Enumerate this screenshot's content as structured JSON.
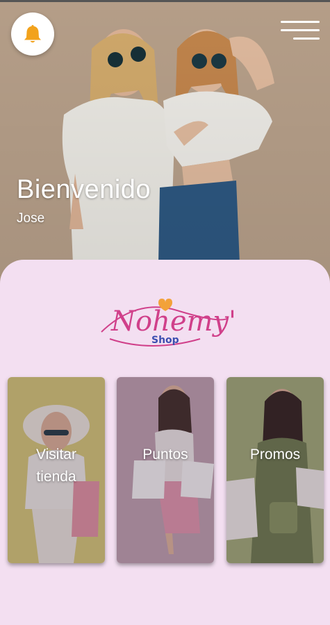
{
  "header": {
    "notifications_icon": "bell-icon",
    "menu_icon": "hamburger-menu-icon"
  },
  "hero": {
    "title": "Bienvenido",
    "user_name": "Jose"
  },
  "brand": {
    "logo_script": "Nohemy's",
    "logo_sub": "Shop",
    "colors": {
      "script": "#d0408a",
      "sub": "#3c4fb0",
      "heart": "#f2a23a",
      "panel": "#f3dff1"
    }
  },
  "cards": [
    {
      "label_line1": "Visitar",
      "label_line2": "tienda"
    },
    {
      "label_line1": "Puntos"
    },
    {
      "label_line1": "Promos"
    }
  ]
}
